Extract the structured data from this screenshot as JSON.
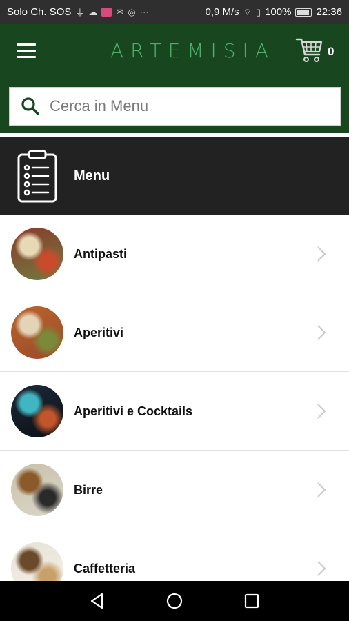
{
  "status_bar": {
    "carrier": "Solo Ch. SOS",
    "speed": "0,9 M/s",
    "battery": "100%",
    "time": "22:36"
  },
  "header": {
    "brand": "ARTEMISIA",
    "cart_count": "0"
  },
  "search": {
    "placeholder": "Cerca in Menu"
  },
  "section": {
    "title": "Menu"
  },
  "categories": [
    {
      "label": "Antipasti",
      "colors": [
        "#8b3a2b",
        "#e8d9b6",
        "#c94b2c",
        "#6f7c3f"
      ]
    },
    {
      "label": "Aperitivi",
      "colors": [
        "#b8642c",
        "#e3d4b8",
        "#7a8a3a",
        "#9c4b2a"
      ]
    },
    {
      "label": "Aperitivi e Cocktails",
      "colors": [
        "#1c2a3a",
        "#3fb6c2",
        "#c2552a",
        "#0d0f14"
      ]
    },
    {
      "label": "Birre",
      "colors": [
        "#c9c0a8",
        "#8a5a2b",
        "#2a2a2a",
        "#d9d6c9"
      ]
    },
    {
      "label": "Caffetteria",
      "colors": [
        "#e8e2d5",
        "#6b4a2c",
        "#c8a06a",
        "#f4f1ea"
      ]
    }
  ],
  "colors": {
    "primary": "#17461f",
    "header_dark": "#222222"
  }
}
